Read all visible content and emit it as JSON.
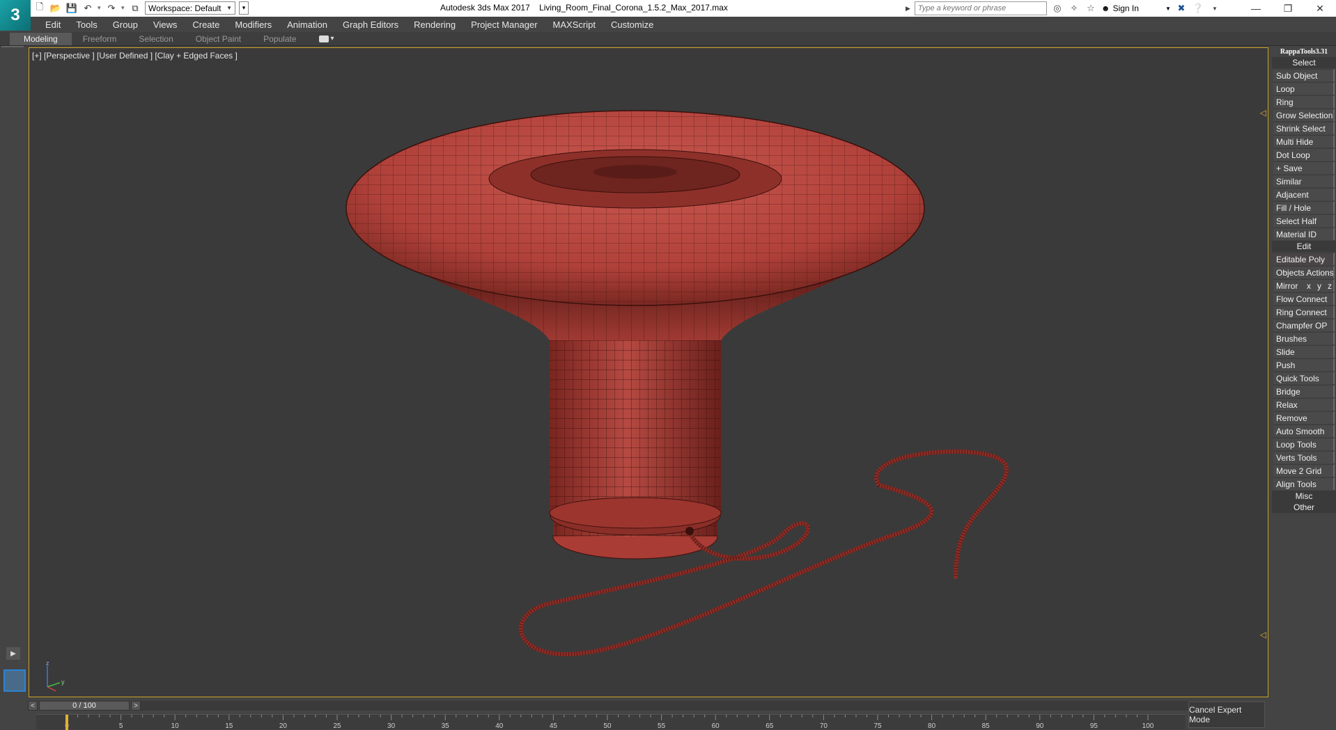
{
  "app": {
    "logo_text": "3",
    "title": "Autodesk 3ds Max 2017",
    "file_name": "Living_Room_Final_Corona_1.5.2_Max_2017.max"
  },
  "toolbar": {
    "workspace_label": "Workspace: Default",
    "search_placeholder": "Type a keyword or phrase",
    "signin_label": "Sign In"
  },
  "menu": [
    "Edit",
    "Tools",
    "Group",
    "Views",
    "Create",
    "Modifiers",
    "Animation",
    "Graph Editors",
    "Rendering",
    "Project Manager",
    "MAXScript",
    "Customize"
  ],
  "ribbon": {
    "tabs": [
      "Modeling",
      "Freeform",
      "Selection",
      "Object Paint",
      "Populate"
    ],
    "active": "Modeling"
  },
  "viewport": {
    "label": "[+] [Perspective ] [User Defined ] [Clay + Edged Faces ]",
    "mesh_color": "#b8423a",
    "wire_color": "#3a100c",
    "axis_labels": [
      "z",
      "y",
      "x"
    ]
  },
  "rappa": {
    "title": "RappaTools3.31",
    "sections": {
      "select": "Select",
      "edit": "Edit",
      "misc": "Misc",
      "other": "Other"
    },
    "select_buttons": [
      "Sub Object",
      "Loop",
      "Ring",
      "Grow Selection",
      "Shrink Select",
      "Multi Hide",
      "Dot Loop",
      "+ Save",
      "Similar",
      "Adjacent",
      "Fill / Hole",
      "Select Half",
      "Material ID"
    ],
    "edit_buttons": [
      "Editable Poly",
      "Objects Actions",
      "Mirror",
      "Flow Connect",
      "Ring Connect",
      "Champfer OP",
      "Brushes",
      "Slide",
      "Push",
      "Quick Tools",
      "Bridge",
      "Relax",
      "Remove",
      "Auto Smooth",
      "Loop Tools",
      "Verts Tools",
      "Move 2 Grid",
      "Align Tools"
    ],
    "mirror_axes": [
      "x",
      "y",
      "z"
    ]
  },
  "timeline": {
    "frame_display": "0 / 100",
    "prev": "<",
    "next": ">",
    "ticks": [
      0,
      5,
      10,
      15,
      20,
      25,
      30,
      35,
      40,
      45,
      50,
      55,
      60,
      65,
      70,
      75,
      80,
      85,
      90,
      95,
      100
    ],
    "current_frame": 0,
    "max_frame": 100
  },
  "status": {
    "cancel_expert_label": "Cancel Expert Mode"
  }
}
